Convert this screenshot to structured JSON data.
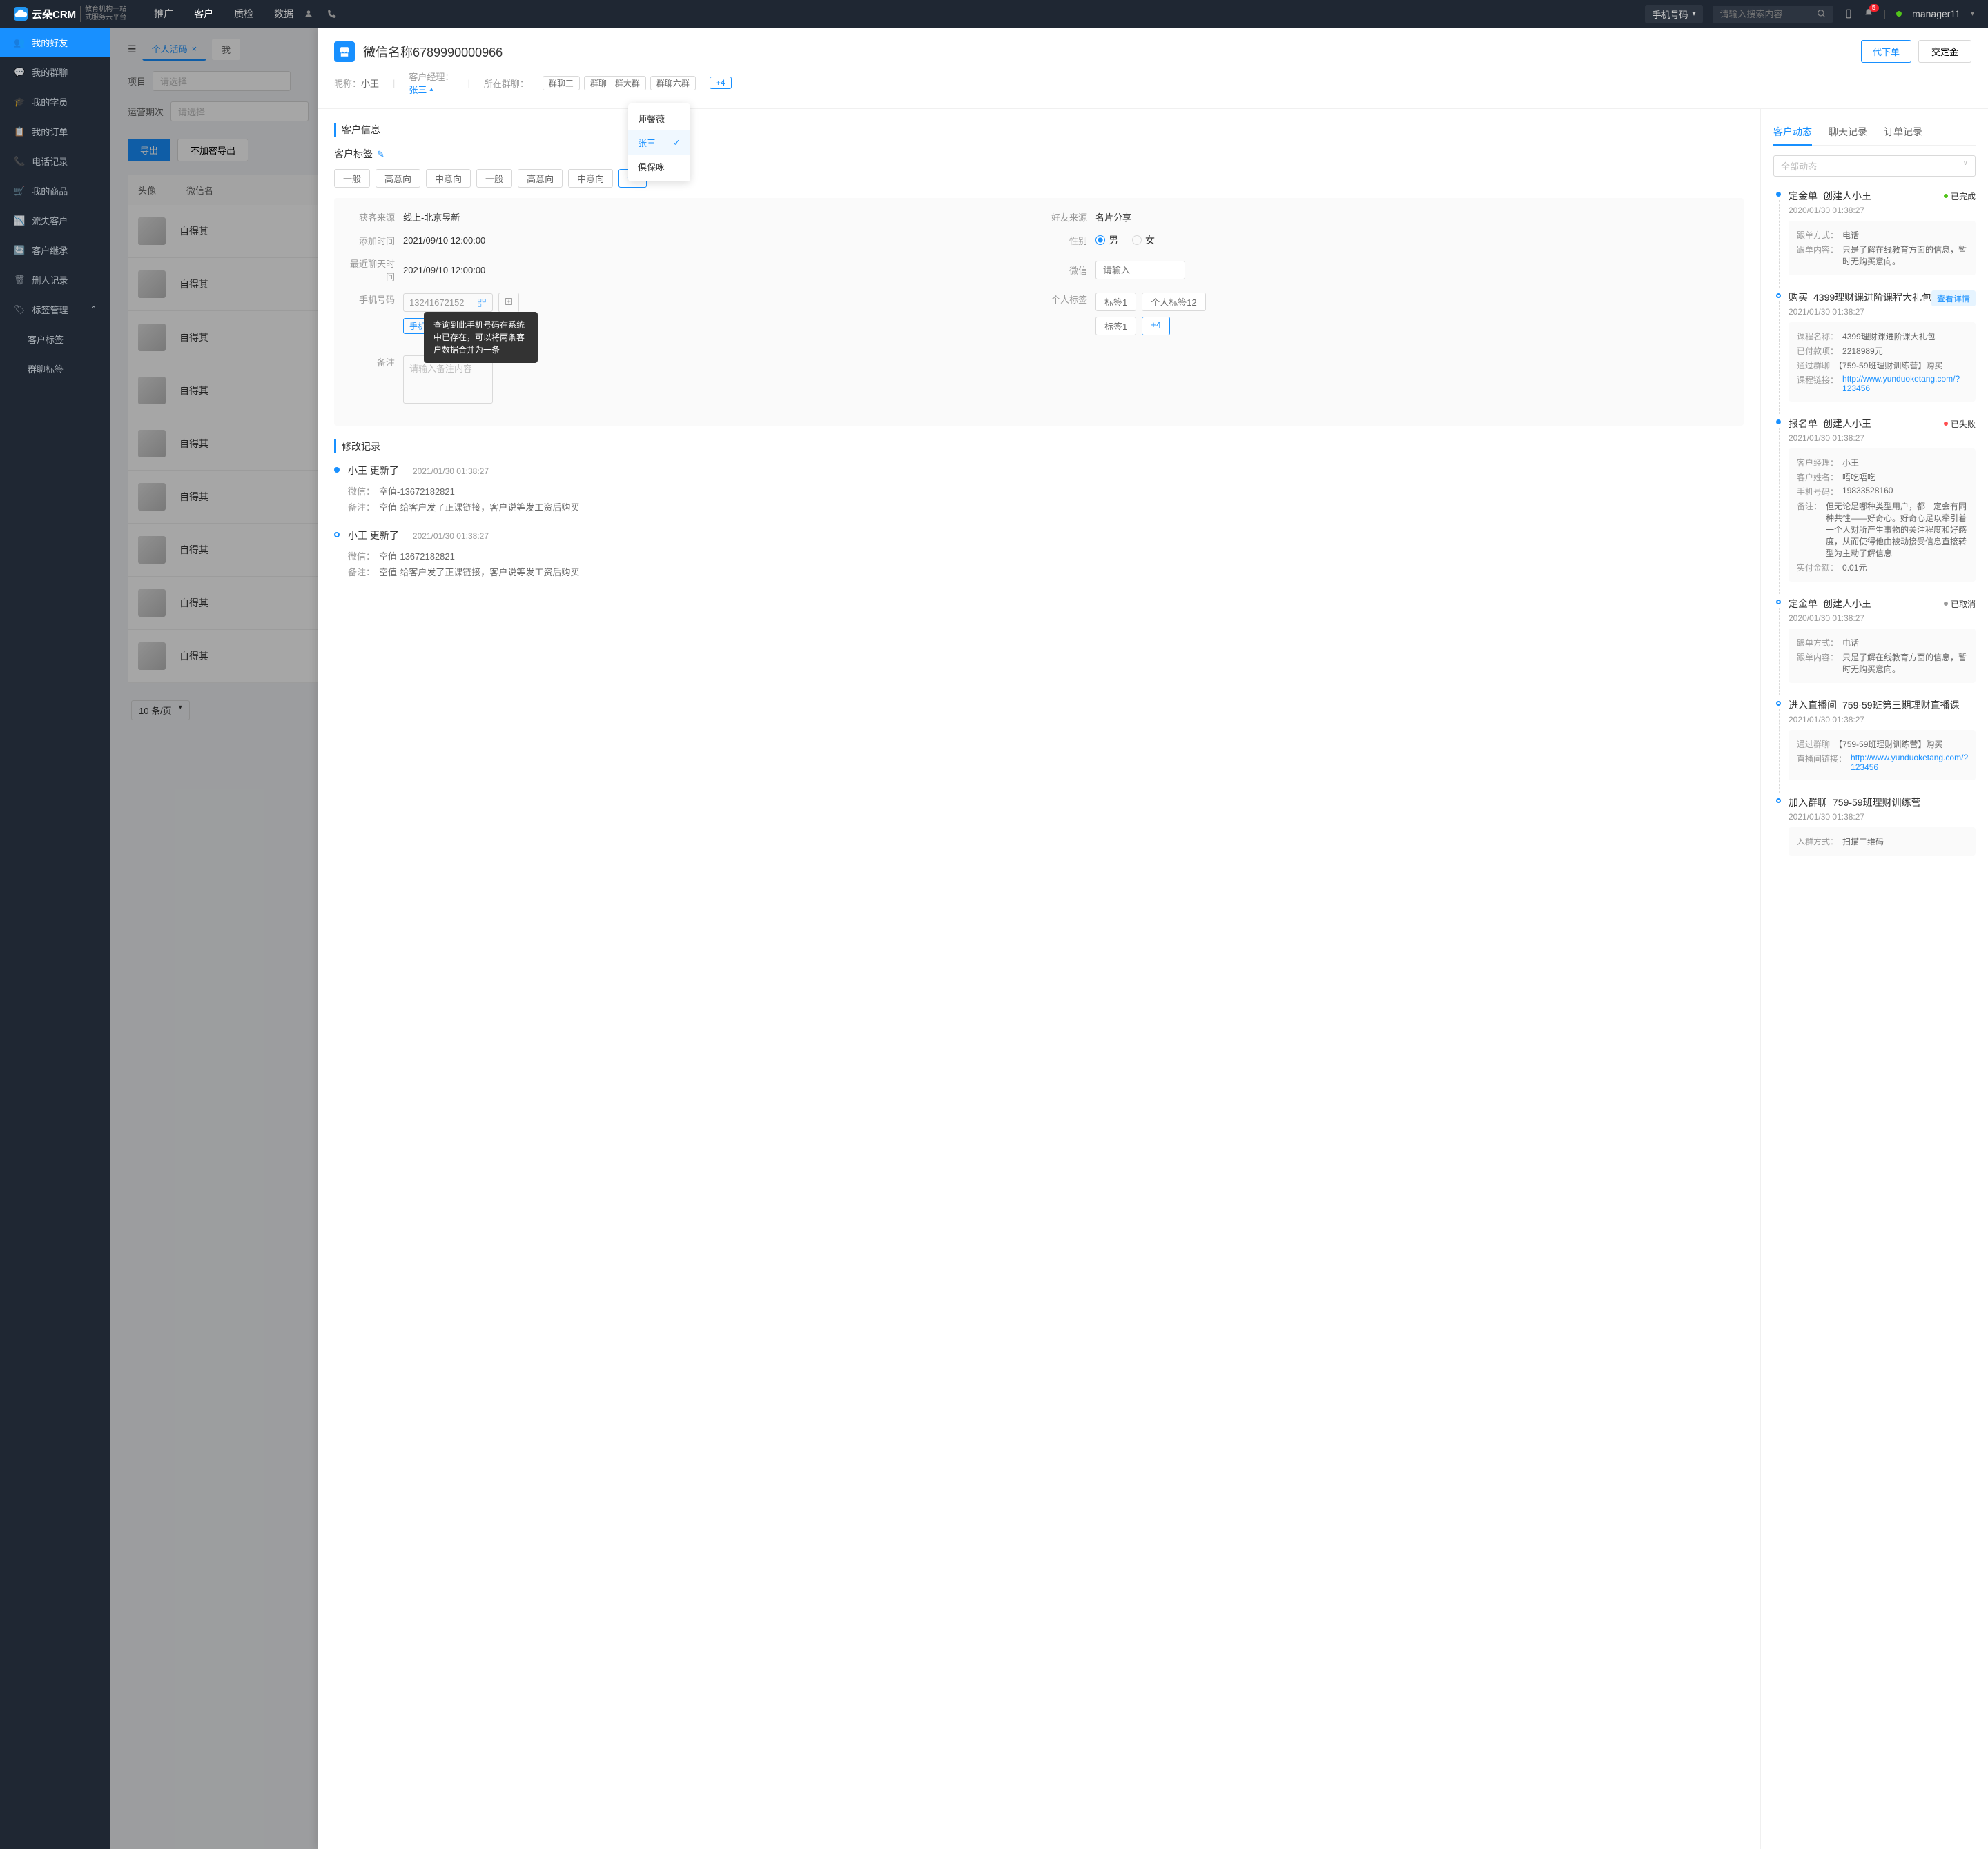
{
  "header": {
    "logo_text": "云朵CRM",
    "logo_sub1": "教育机构一站",
    "logo_sub2": "式服务云平台",
    "nav": [
      "推广",
      "客户",
      "质检",
      "数据"
    ],
    "active_nav": 1,
    "search_type": "手机号码",
    "search_placeholder": "请输入搜索内容",
    "user": "manager11",
    "notif_count": "5"
  },
  "sidebar": {
    "items": [
      {
        "label": "我的好友"
      },
      {
        "label": "我的群聊"
      },
      {
        "label": "我的学员"
      },
      {
        "label": "我的订单"
      },
      {
        "label": "电话记录"
      },
      {
        "label": "我的商品"
      },
      {
        "label": "流失客户"
      },
      {
        "label": "客户继承"
      },
      {
        "label": "删人记录"
      },
      {
        "label": "标签管理"
      }
    ],
    "subs": [
      "客户标签",
      "群聊标签"
    ]
  },
  "bg": {
    "tab": "个人活码",
    "tab2": "我",
    "filter1_label": "项目",
    "filter2_label": "运营期次",
    "placeholder": "请选择",
    "export": "导出",
    "no_encrypt": "不加密导出",
    "col_avatar": "头像",
    "col_name": "微信名",
    "cell_text": "自得其",
    "page_size": "10 条/页"
  },
  "drawer": {
    "title": "微信名称6789990000966",
    "nickname_label": "昵称：",
    "nickname": "小王",
    "mgr_label": "客户经理：",
    "mgr": "张三",
    "groups_label": "所在群聊：",
    "groups": [
      "群聊三",
      "群聊一群大群",
      "群聊六群"
    ],
    "groups_more": "+4",
    "btn_order": "代下单",
    "btn_deposit": "交定金"
  },
  "dropdown": {
    "items": [
      "师馨薇",
      "张三",
      "俱保咏"
    ],
    "selected": 1
  },
  "info": {
    "section_title": "客户信息",
    "tags_title": "客户标签",
    "tags1": [
      "一般",
      "高意向",
      "中意向",
      "一般",
      "高意向",
      "中意向"
    ],
    "tags_more": "+4",
    "source_label": "获客来源",
    "source": "线上-北京昱新",
    "friend_label": "好友来源",
    "friend": "名片分享",
    "add_time_label": "添加时间",
    "add_time": "2021/09/10 12:00:00",
    "gender_label": "性别",
    "gender_m": "男",
    "gender_f": "女",
    "last_chat_label": "最近聊天时间",
    "last_chat": "2021/09/10 12:00:00",
    "wechat_label": "微信",
    "wechat_placeholder": "请输入",
    "phone_label": "手机号码",
    "phone": "13241672152",
    "phone_tags": [
      "手机"
    ],
    "tooltip": "查询到此手机号码在系统中已存在，可以将两条客户数据合并为一条",
    "ptag_label": "个人标签",
    "ptags": [
      "标签1",
      "个人标签12",
      "标签1"
    ],
    "ptag_more": "+4",
    "remark_label": "备注",
    "remark_placeholder": "请输入备注内容"
  },
  "history": {
    "title": "修改记录",
    "items": [
      {
        "name": "小王 更新了",
        "date": "2021/01/30  01:38:27",
        "lines": [
          {
            "label": "微信：",
            "val": "空值-13672182821"
          },
          {
            "label": "备注：",
            "val": "空值-给客户发了正课链接，客户说等发工资后购买"
          }
        ]
      },
      {
        "name": "小王 更新了",
        "date": "2021/01/30  01:38:27",
        "lines": [
          {
            "label": "微信：",
            "val": "空值-13672182821"
          },
          {
            "label": "备注：",
            "val": "空值-给客户发了正课链接，客户说等发工资后购买"
          }
        ]
      }
    ]
  },
  "right": {
    "tabs": [
      "客户动态",
      "聊天记录",
      "订单记录"
    ],
    "filter": "全部动态",
    "timeline": [
      {
        "title": "定金单",
        "sub": "创建人小王",
        "date": "2020/01/30  01:38:27",
        "status": "已完成",
        "sc": "#52c41a",
        "box": [
          {
            "label": "跟单方式：",
            "val": "电话"
          },
          {
            "label": "跟单内容：",
            "val": "只是了解在线教育方面的信息，暂时无购买意向。"
          }
        ],
        "filled": true
      },
      {
        "title": "购买",
        "sub": "4399理财课进阶课程大礼包",
        "date": "2021/01/30  01:38:27",
        "detail": "查看详情",
        "box": [
          {
            "label": "课程名称：",
            "val": "4399理财课进阶课大礼包"
          },
          {
            "label": "已付款项：",
            "val": "2218989元"
          },
          {
            "label": "通过群聊",
            "val": "【759-59班理财训练营】购买"
          },
          {
            "label": "课程链接：",
            "val": "http://www.yunduoketang.com/?123456",
            "link": true
          }
        ]
      },
      {
        "title": "报名单",
        "sub": "创建人小王",
        "date": "2021/01/30  01:38:27",
        "status": "已失败",
        "sc": "#ff4d4f",
        "box": [
          {
            "label": "客户经理：",
            "val": "小王"
          },
          {
            "label": "客户姓名：",
            "val": "唔吃唔吃"
          },
          {
            "label": "手机号码：",
            "val": "19833528160"
          },
          {
            "label": "备注：",
            "val": "但无论是哪种类型用户，都一定会有同种共性——好奇心。好奇心足以牵引着一个人对所产生事物的关注程度和好感度，从而使得他由被动接受信息直接转型为主动了解信息"
          },
          {
            "label": "实付金额：",
            "val": "0.01元"
          }
        ],
        "filled": true
      },
      {
        "title": "定金单",
        "sub": "创建人小王",
        "date": "2020/01/30  01:38:27",
        "status": "已取消",
        "sc": "#999",
        "box": [
          {
            "label": "跟单方式：",
            "val": "电话"
          },
          {
            "label": "跟单内容：",
            "val": "只是了解在线教育方面的信息，暂时无购买意向。"
          }
        ]
      },
      {
        "title": "进入直播间",
        "sub": "759-59班第三期理财直播课",
        "date": "2021/01/30  01:38:27",
        "box": [
          {
            "label": "通过群聊",
            "val": "【759-59班理财训练营】购买"
          },
          {
            "label": "直播间链接：",
            "val": "http://www.yunduoketang.com/?123456",
            "link": true
          }
        ]
      },
      {
        "title": "加入群聊",
        "sub": "759-59班理财训练营",
        "date": "2021/01/30  01:38:27",
        "box": [
          {
            "label": "入群方式：",
            "val": "扫描二维码"
          }
        ]
      }
    ]
  }
}
